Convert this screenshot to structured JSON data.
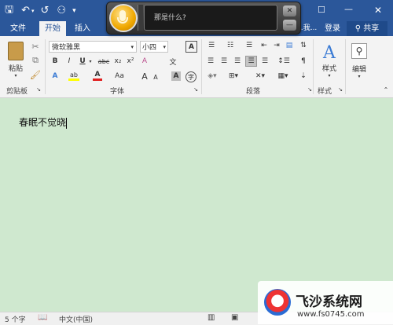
{
  "window": {
    "restore_icon": "restore-window-icon",
    "close_glyph": "✕",
    "restore_glyph": "☐",
    "minimize_glyph": "—"
  },
  "quick_access": {
    "save_glyph": "🖫",
    "undo_glyph": "↶",
    "redo_glyph": "↺",
    "touch_glyph": "⚇"
  },
  "tabs": [
    "文件",
    "开始",
    "插入"
  ],
  "tabs_right": {
    "tell_me": "…我...",
    "login": "登录",
    "share": "共享"
  },
  "voice_prompt": {
    "text": "那是什么?"
  },
  "ribbon": {
    "paste_label": "粘贴",
    "font_name": "微软雅黑",
    "font_size": "小四",
    "font_group": "字体",
    "clipboard_group": "剪贴板",
    "paragraph_group": "段落",
    "styles_group": "样式",
    "styles_label": "样式",
    "editing_label": "编辑",
    "bold": "B",
    "italic": "I",
    "underline": "U",
    "strike": "abc",
    "subscript": "x₂",
    "superscript": "x²",
    "clear_format": "A",
    "text_effect": "A",
    "highlight": "ab",
    "font_color": "A",
    "change_case": "Aa",
    "grow": "A",
    "shrink": "A",
    "char_border": "A",
    "char_shading": "A",
    "phonetic": "文"
  },
  "document": {
    "text": "春眠不觉晓"
  },
  "statusbar": {
    "word_count": "5 个字",
    "language": "中文(中国)"
  },
  "watermark": {
    "title": "飞沙系统网",
    "url": "www.fs0745.com"
  },
  "colors": {
    "accent": "#2b579a",
    "doc_bg": "#cfe8cf",
    "highlight": "#ffff00",
    "font_red": "#e02020"
  }
}
